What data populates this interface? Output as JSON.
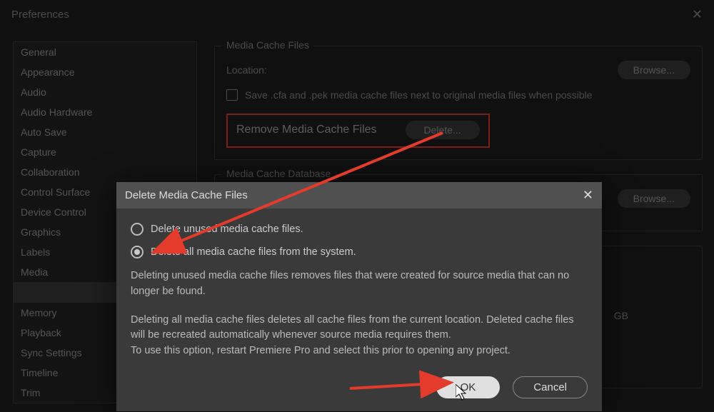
{
  "window": {
    "title": "Preferences"
  },
  "sidebar": {
    "items": [
      {
        "label": "General"
      },
      {
        "label": "Appearance"
      },
      {
        "label": "Audio"
      },
      {
        "label": "Audio Hardware"
      },
      {
        "label": "Auto Save"
      },
      {
        "label": "Capture"
      },
      {
        "label": "Collaboration"
      },
      {
        "label": "Control Surface"
      },
      {
        "label": "Device Control"
      },
      {
        "label": "Graphics"
      },
      {
        "label": "Labels"
      },
      {
        "label": "Media"
      },
      {
        "label": ""
      },
      {
        "label": "Memory"
      },
      {
        "label": "Playback"
      },
      {
        "label": "Sync Settings"
      },
      {
        "label": "Timeline"
      },
      {
        "label": "Trim"
      }
    ],
    "selected_index": 12
  },
  "panel": {
    "section1": {
      "title": "Media Cache Files",
      "location_label": "Location:",
      "browse_label": "Browse...",
      "checkbox_label": "Save .cfa and .pek media cache files next to original media files when possible",
      "remove_row": {
        "label": "Remove Media Cache Files",
        "button": "Delete..."
      }
    },
    "section2": {
      "title": "Media Cache Database",
      "browse_label": "Browse..."
    },
    "gb_label": "GB"
  },
  "dialog": {
    "title": "Delete Media Cache Files",
    "option1": "Delete unused media cache files.",
    "option2": "Delete all media cache files from the system.",
    "desc1": "Deleting unused media cache files removes files that were created for source media that can no longer be found.",
    "desc2": "Deleting all media cache files deletes all cache files from the current location. Deleted cache files will be recreated automatically whenever source media requires them.",
    "desc3": "To use this option, restart Premiere Pro and select this prior to opening any project.",
    "ok": "OK",
    "cancel": "Cancel"
  },
  "annotation": {
    "arrow_color": "#e43b2c"
  }
}
